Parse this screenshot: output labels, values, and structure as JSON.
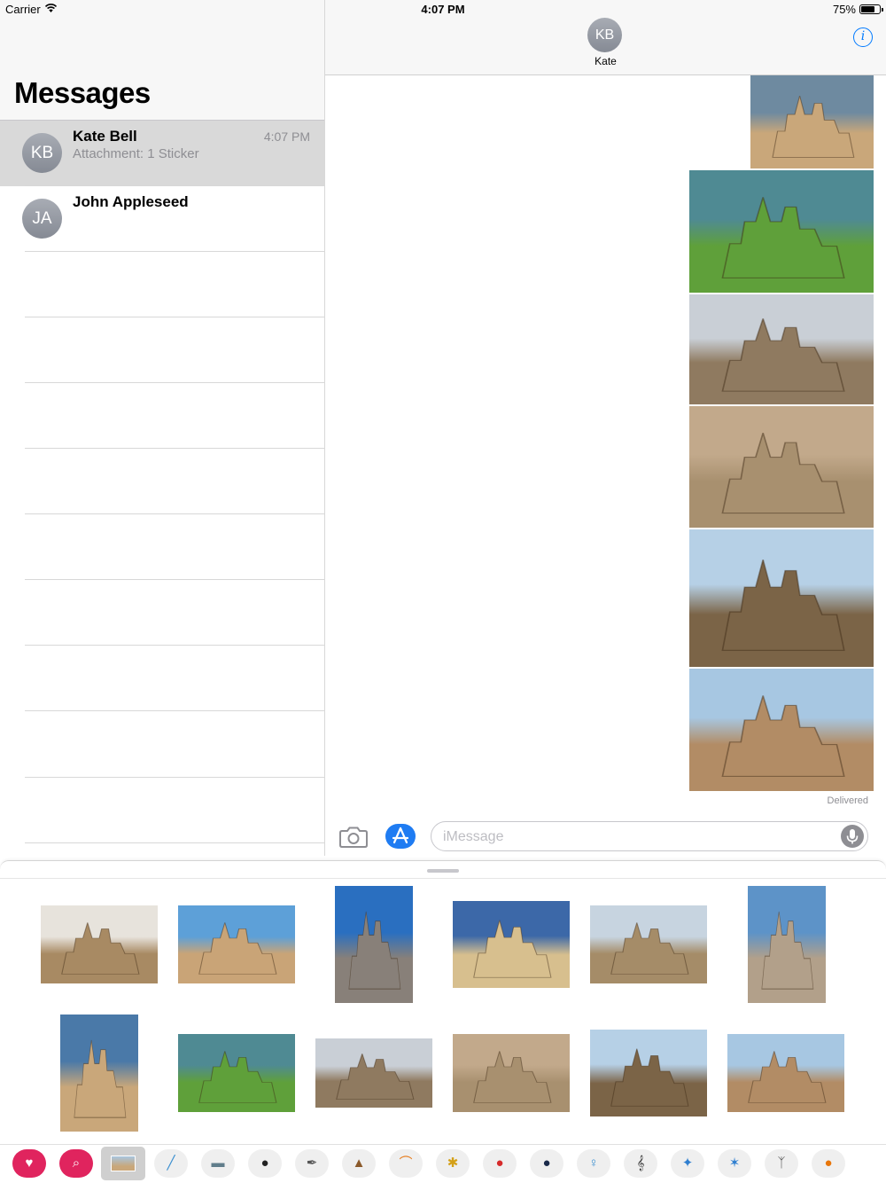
{
  "status_bar": {
    "carrier": "Carrier",
    "time": "4:07 PM",
    "battery": "75%",
    "battery_level": 0.75
  },
  "sidebar": {
    "title": "Messages",
    "conversations": [
      {
        "initials": "KB",
        "name": "Kate Bell",
        "preview": "Attachment: 1 Sticker",
        "time": "4:07 PM",
        "selected": true
      },
      {
        "initials": "JA",
        "name": "John Appleseed",
        "preview": "",
        "time": "",
        "selected": false
      }
    ]
  },
  "conversation": {
    "initials": "KB",
    "contact_name": "Kate",
    "info_icon": "info-icon",
    "photos": [
      {
        "name": "sandcastle-tower-closeup",
        "colors": [
          "#6e8aa0",
          "#c9a77a"
        ]
      },
      {
        "name": "sandcastle-lakeside-grass",
        "colors": [
          "#4f8a93",
          "#5fa03a"
        ]
      },
      {
        "name": "sandcastle-overcast-beach",
        "colors": [
          "#c9cfd6",
          "#8f7a60"
        ]
      },
      {
        "name": "sandcastle-silver-turrets",
        "colors": [
          "#c2a98b",
          "#a8906f"
        ]
      },
      {
        "name": "sandcastle-tall-tower",
        "colors": [
          "#b6d0e6",
          "#7b6447"
        ]
      },
      {
        "name": "sandcastle-beach-shore",
        "colors": [
          "#a7c7e2",
          "#b28c65"
        ]
      }
    ],
    "status": "Delivered"
  },
  "compose": {
    "camera_icon": "camera-icon",
    "app_store_icon": "app-store-icon",
    "placeholder": "iMessage",
    "mic_icon": "microphone-icon"
  },
  "sticker_drawer": {
    "stickers": [
      {
        "name": "sticker-spiky-sandcastle",
        "colors": [
          "#e7e3dc",
          "#a88a63"
        ]
      },
      {
        "name": "sticker-palace-sandcastle",
        "colors": [
          "#5da0d8",
          "#c9a477"
        ]
      },
      {
        "name": "sticker-cathedral-spire",
        "colors": [
          "#2a6fc0",
          "#888079"
        ]
      },
      {
        "name": "sticker-pyramid-sandcastle",
        "colors": [
          "#3c68a8",
          "#d7bf8e"
        ]
      },
      {
        "name": "sticker-mound-sandcastle",
        "colors": [
          "#c7d4e0",
          "#a58c68"
        ]
      },
      {
        "name": "sticker-fairy-castle",
        "colors": [
          "#5d93c8",
          "#b2a08a"
        ]
      },
      {
        "name": "sticker-tower-closeup",
        "colors": [
          "#4a79a8",
          "#c9a77a"
        ]
      },
      {
        "name": "sticker-lakeside-castle",
        "colors": [
          "#4f8a93",
          "#5fa03a"
        ]
      },
      {
        "name": "sticker-overcast-castle",
        "colors": [
          "#c9cfd6",
          "#8f7a60"
        ]
      },
      {
        "name": "sticker-silver-turrets",
        "colors": [
          "#c2a98b",
          "#a8906f"
        ]
      },
      {
        "name": "sticker-tall-tower",
        "colors": [
          "#b6d0e6",
          "#7b6447"
        ]
      },
      {
        "name": "sticker-beach-shore",
        "colors": [
          "#a7c7e2",
          "#b28c65"
        ]
      }
    ]
  },
  "app_bar": {
    "apps": [
      {
        "name": "heart-app-icon",
        "glyph": "♥"
      },
      {
        "name": "search-images-app-icon",
        "glyph": "⌕"
      },
      {
        "name": "sandcastle-app-icon",
        "glyph": "",
        "selected": true
      },
      {
        "name": "bottle-icon",
        "glyph": "╱"
      },
      {
        "name": "photo-icon",
        "glyph": "▬"
      },
      {
        "name": "bowler-hat-icon",
        "glyph": "●"
      },
      {
        "name": "feather-icon",
        "glyph": "✒"
      },
      {
        "name": "poop-icon",
        "glyph": "▲"
      },
      {
        "name": "rainbow-icon",
        "glyph": "⌒"
      },
      {
        "name": "bee-icon",
        "glyph": "✱"
      },
      {
        "name": "ladybug-icon",
        "glyph": "●"
      },
      {
        "name": "globe-icon",
        "glyph": "●"
      },
      {
        "name": "balloon-icon",
        "glyph": "♀"
      },
      {
        "name": "treble-clef-icon",
        "glyph": "𝄞"
      },
      {
        "name": "dancer-icon",
        "glyph": "✦"
      },
      {
        "name": "stick-figure-icon",
        "glyph": "✶"
      },
      {
        "name": "figure-skater-icon",
        "glyph": "ᛉ"
      },
      {
        "name": "pumpkin-icon",
        "glyph": "●"
      },
      {
        "name": "sun-icon",
        "glyph": "☀"
      }
    ]
  }
}
